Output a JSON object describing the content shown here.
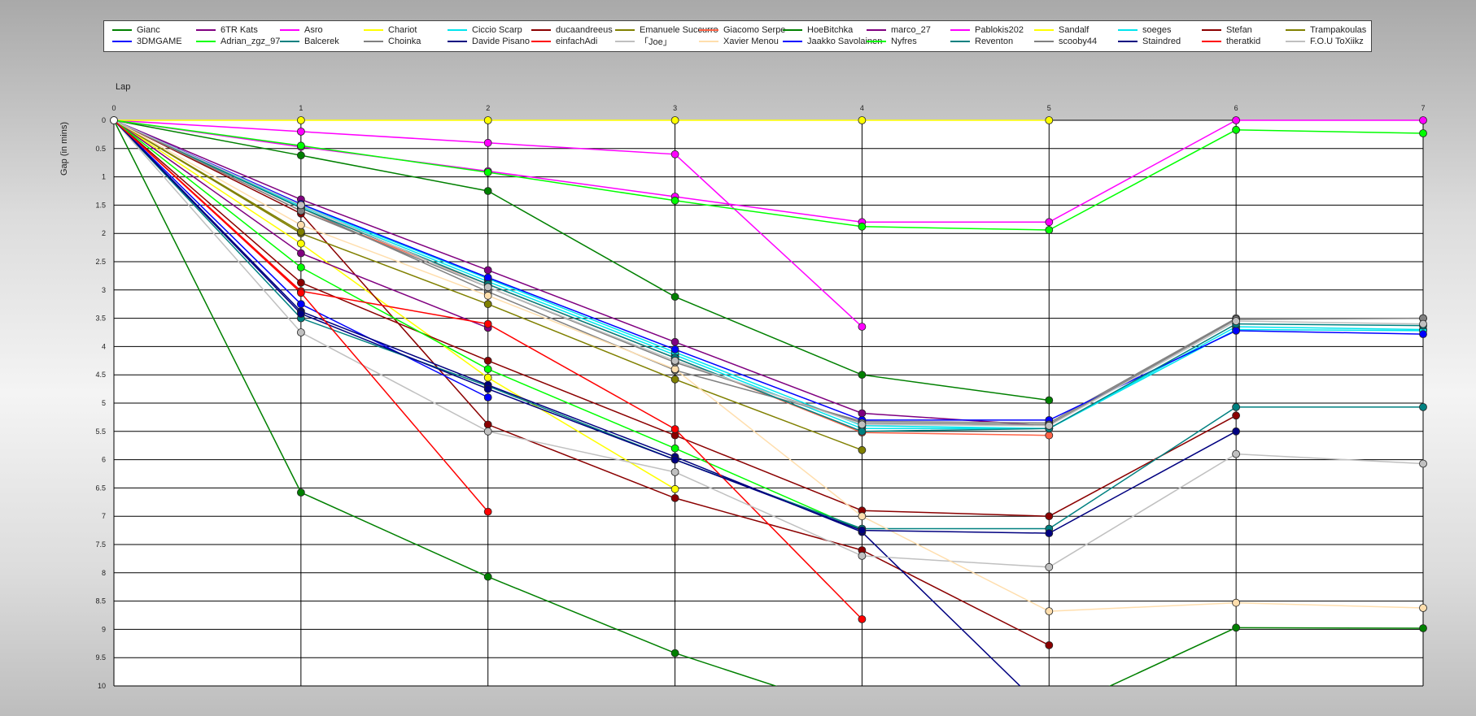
{
  "chart_data": {
    "type": "line",
    "title": "",
    "xlabel": "Lap",
    "ylabel": "Gap (in mins)",
    "x": [
      0,
      1,
      2,
      3,
      4,
      5,
      6,
      7
    ],
    "x_ticks": [
      "0",
      "1",
      "2",
      "3",
      "4",
      "5",
      "6",
      "7"
    ],
    "y_ticks": [
      "0",
      "0.5",
      "1",
      "1.5",
      "2",
      "2.5",
      "3",
      "3.5",
      "4",
      "4.5",
      "5",
      "5.5",
      "6",
      "6.5",
      "7",
      "7.5",
      "8",
      "8.5",
      "9",
      "9.5",
      "10"
    ],
    "xlim": [
      0,
      7
    ],
    "ylim": [
      0,
      10
    ],
    "y_inverted": true,
    "grid": true,
    "legend_position": "top",
    "series": [
      {
        "name": "Gianc",
        "color": "#008000",
        "values": [
          0,
          0.62,
          1.25,
          3.12,
          4.5,
          4.95,
          null,
          null
        ]
      },
      {
        "name": "6TR Kats",
        "color": "#800080",
        "values": [
          0,
          1.4,
          2.65,
          3.92,
          5.18,
          5.4,
          null,
          null
        ]
      },
      {
        "name": "Asro",
        "color": "#ff00ff",
        "values": [
          0,
          0.2,
          0.4,
          0.6,
          3.65,
          null,
          null,
          null
        ]
      },
      {
        "name": "Chariot",
        "color": "#ffff00",
        "values": [
          0,
          2.18,
          4.55,
          6.52,
          null,
          null,
          null,
          null
        ]
      },
      {
        "name": "Ciccio Scarp",
        "color": "#00e5ee",
        "values": [
          0,
          1.52,
          2.85,
          4.15,
          5.45,
          5.45,
          3.65,
          3.7
        ]
      },
      {
        "name": "ducaandreeus",
        "color": "#8b0000",
        "values": [
          0,
          1.65,
          5.38,
          6.68,
          7.6,
          9.28,
          null,
          null
        ]
      },
      {
        "name": "Emanuele Succurro",
        "color": "#808000",
        "values": [
          0,
          2.0,
          3.25,
          4.58,
          5.83,
          null,
          null,
          null
        ]
      },
      {
        "name": "Giacomo Serpe",
        "color": "#ff6347",
        "values": [
          0,
          1.6,
          2.9,
          4.2,
          5.52,
          5.57,
          null,
          null
        ]
      },
      {
        "name": "HoeBitchka",
        "color": "#008000",
        "values": [
          0,
          6.58,
          8.07,
          9.42,
          10.5,
          10.5,
          8.97,
          8.98
        ]
      },
      {
        "name": "marco_27",
        "color": "#800080",
        "values": [
          0,
          2.35,
          3.67,
          null,
          null,
          null,
          null,
          null
        ]
      },
      {
        "name": "Pablokis202",
        "color": "#ff00ff",
        "values": [
          0,
          0.47,
          0.9,
          1.35,
          1.8,
          1.8,
          0,
          0
        ]
      },
      {
        "name": "Sandalf",
        "color": "#ffff00",
        "values": [
          0,
          0,
          0,
          0,
          0,
          0,
          null,
          null
        ]
      },
      {
        "name": "soeges",
        "color": "#00e5ee",
        "values": [
          0,
          1.5,
          2.8,
          4.1,
          5.4,
          5.45,
          3.7,
          3.72
        ]
      },
      {
        "name": "Stefan",
        "color": "#8b0000",
        "values": [
          0,
          2.87,
          4.25,
          5.57,
          6.9,
          7.0,
          5.22,
          null
        ]
      },
      {
        "name": "Trampakoulas",
        "color": "#808000",
        "values": [
          0,
          1.97,
          null,
          null,
          null,
          null,
          null,
          null
        ]
      },
      {
        "name": "3DMGAME",
        "color": "#0000ff",
        "values": [
          0,
          3.25,
          4.9,
          null,
          null,
          null,
          null,
          null
        ]
      },
      {
        "name": "Adrian_zgz_97",
        "color": "#00ff00",
        "values": [
          0,
          2.6,
          4.4,
          5.8,
          7.25,
          null,
          null,
          null
        ]
      },
      {
        "name": "Balcerek",
        "color": "#008080",
        "values": [
          0,
          3.5,
          4.7,
          6.0,
          7.22,
          7.22,
          5.07,
          5.07
        ]
      },
      {
        "name": "Choinka",
        "color": "#808080",
        "values": [
          0,
          1.55,
          3.03,
          4.42,
          5.32,
          5.35,
          3.5,
          3.5
        ]
      },
      {
        "name": "Davide Pisano",
        "color": "#000080",
        "values": [
          0,
          3.38,
          4.68,
          5.95,
          7.28,
          10.5,
          null,
          null
        ]
      },
      {
        "name": "einfachAdi",
        "color": "#ff0000",
        "values": [
          0,
          3.02,
          3.6,
          5.46,
          8.82,
          null,
          null,
          null
        ]
      },
      {
        "name": "「Joe」",
        "color": "#c0c0c0",
        "values": [
          0,
          3.75,
          5.5,
          6.22,
          7.7,
          7.9,
          5.9,
          6.07
        ]
      },
      {
        "name": "Xavier Menou",
        "color": "#ffdead",
        "values": [
          0,
          1.85,
          3.1,
          4.4,
          7.0,
          8.68,
          8.53,
          8.62
        ]
      },
      {
        "name": "Jaakko Savolainen",
        "color": "#0000ff",
        "values": [
          0,
          1.48,
          2.78,
          4.05,
          5.3,
          5.3,
          3.72,
          3.78
        ]
      },
      {
        "name": "Nyfres",
        "color": "#00ff00",
        "values": [
          0,
          0.45,
          0.92,
          1.42,
          1.88,
          1.94,
          0.17,
          0.23
        ]
      },
      {
        "name": "Reventon",
        "color": "#008080",
        "values": [
          0,
          1.55,
          2.9,
          4.2,
          5.5,
          5.45,
          3.6,
          3.63
        ]
      },
      {
        "name": "scooby44",
        "color": "#808080",
        "values": [
          0,
          1.6,
          2.95,
          4.28,
          5.35,
          5.38,
          3.52,
          3.5
        ]
      },
      {
        "name": "Staindred",
        "color": "#000080",
        "values": [
          0,
          3.42,
          4.75,
          6.0,
          7.25,
          7.3,
          5.5,
          null
        ]
      },
      {
        "name": "theratkid",
        "color": "#ff0000",
        "values": [
          0,
          3.05,
          6.92,
          null,
          null,
          null,
          null,
          null
        ]
      },
      {
        "name": "F.O.U ToXiikz",
        "color": "#c0c0c0",
        "values": [
          0,
          1.5,
          2.95,
          4.25,
          5.38,
          5.4,
          3.55,
          3.6
        ]
      }
    ]
  }
}
